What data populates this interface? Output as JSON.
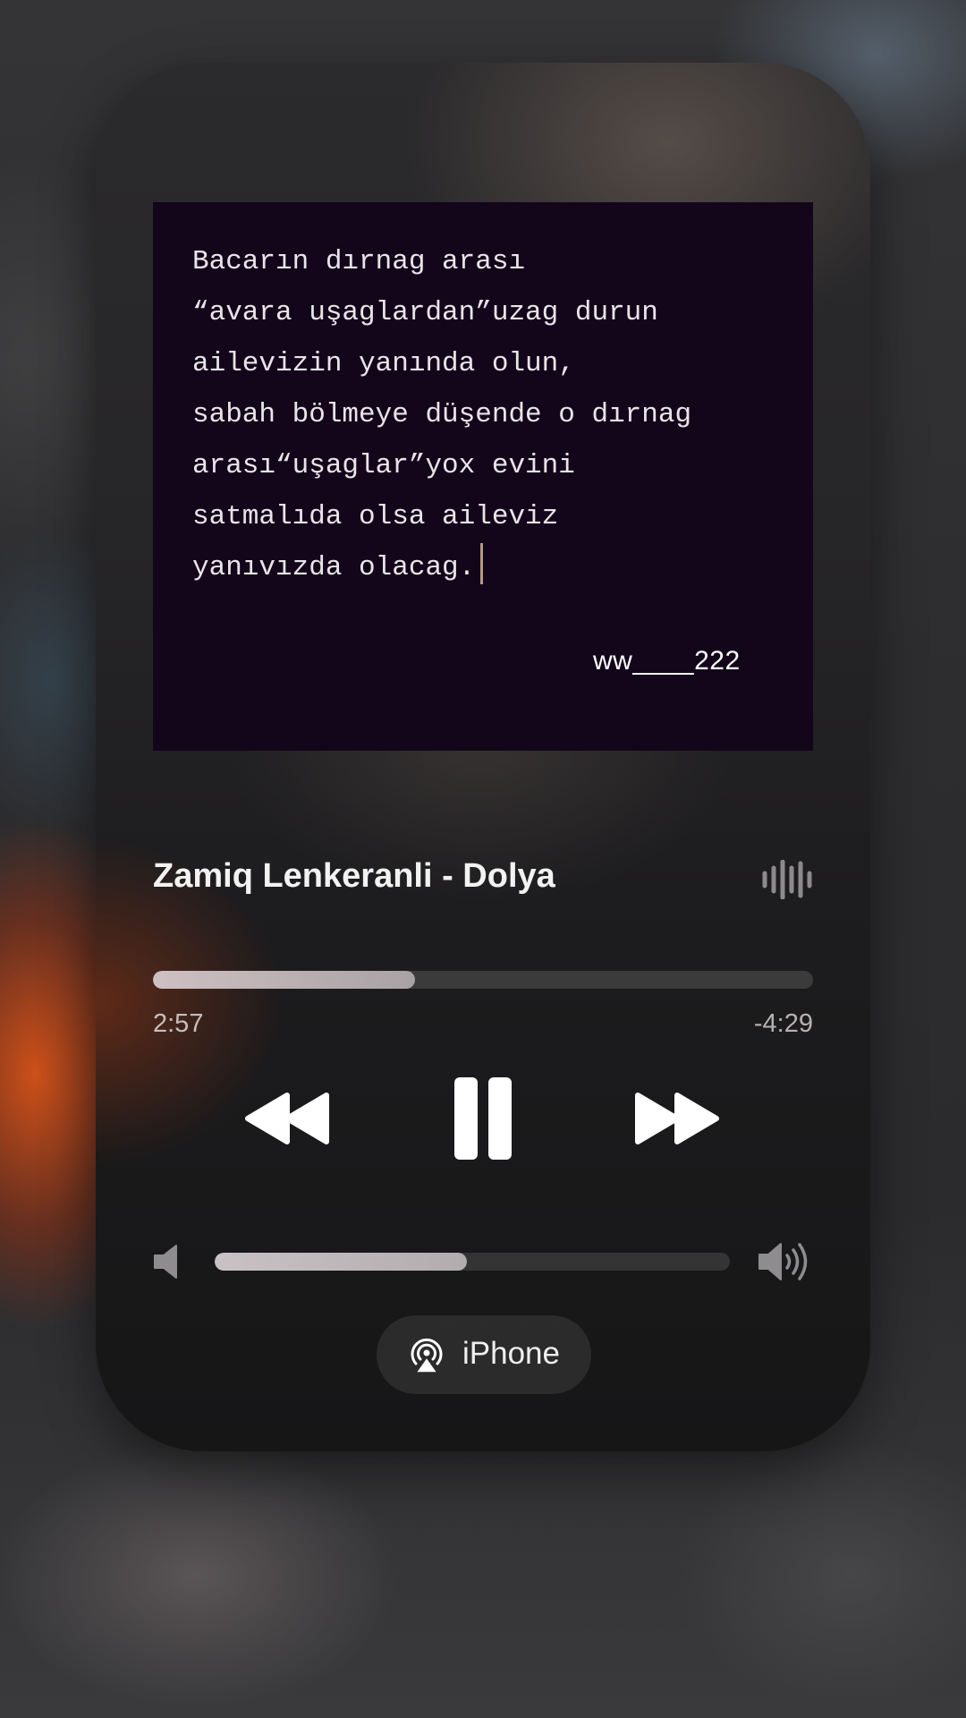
{
  "artwork": {
    "lines": [
      "Bacarın dırnag arası",
      "“avara uşaglardan”uzag durun",
      "ailevizin yanında olun,",
      "sabah bölmeye düşende o dırnag",
      "arası“uşaglar”yox evini",
      "satmalıda olsa aileviz",
      "yanıvızda olacag."
    ],
    "signature": "ww____222"
  },
  "track": {
    "title": "Zamiq Lenkeranli - Dolya"
  },
  "playback": {
    "elapsed": "2:57",
    "remaining": "-4:29",
    "progress": 0.397,
    "state": "playing"
  },
  "volume": {
    "level": 0.49
  },
  "output": {
    "device": "iPhone",
    "icon": "airplay-icon"
  },
  "icons": {
    "lyrics": "waveform-icon",
    "previous": "rewind-icon",
    "play_pause": "pause-icon",
    "next": "fast-forward-icon",
    "volume_min": "speaker-low-icon",
    "volume_max": "speaker-high-icon"
  },
  "colors": {
    "artwork_bg": "#13061b",
    "artwork_text": "#e9e4e8",
    "cursor": "#b59a80",
    "progress_fill": "#cfc0c2",
    "track_bg": "rgba(255,255,255,0.14)"
  }
}
